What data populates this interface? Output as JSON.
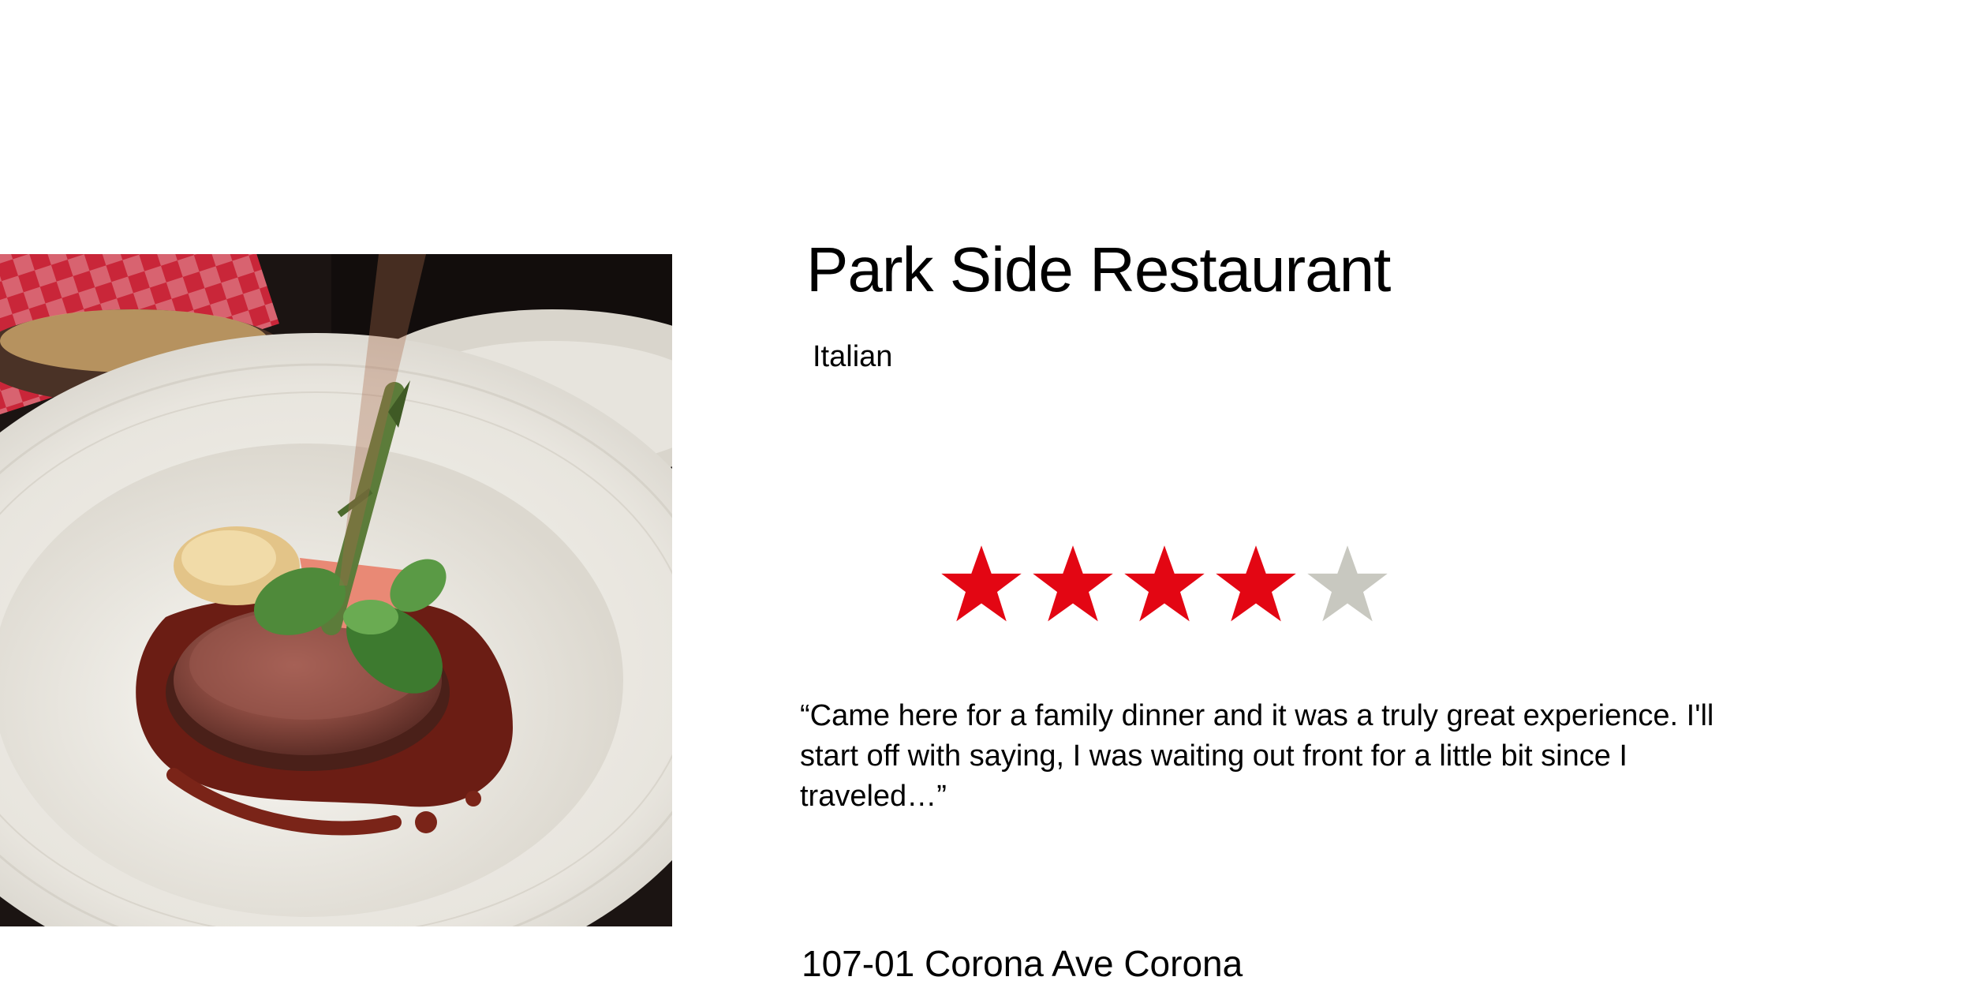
{
  "restaurant": {
    "name": "Park Side Restaurant",
    "cuisine": "Italian",
    "rating": 4,
    "rating_max": 5,
    "review": "“Came here for a family dinner and it was a truly great experience. I'll start off with saying, I was waiting out front for a little bit since I traveled…”",
    "address": "107-01 Corona Ave Corona"
  },
  "colors": {
    "star_filled": "#e30613",
    "star_empty": "#c8c8c0"
  },
  "photo": {
    "icon": "food-photo"
  }
}
